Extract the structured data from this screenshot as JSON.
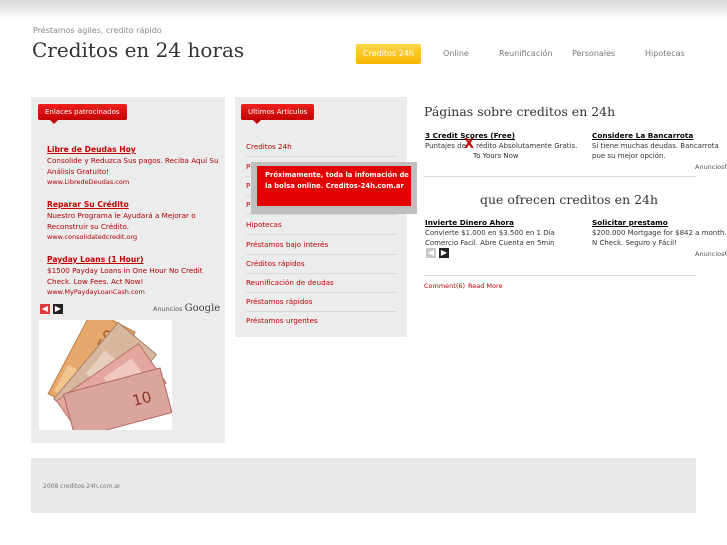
{
  "header": {
    "tagline": "Préstamos agiles, credito rápido",
    "site_title": "Creditos en 24 horas"
  },
  "nav": [
    {
      "label": "Creditos 24h",
      "active": true
    },
    {
      "label": "Online"
    },
    {
      "label": "Reunificación"
    },
    {
      "label": "Personales"
    },
    {
      "label": "Hipotecas"
    }
  ],
  "sidebar": {
    "title": "Enlaces patrocinados",
    "ads": [
      {
        "title": "Libre de Deudas Hoy",
        "desc": "Consolide y Reduzca Sus pagos. Reciba Aquí Su Análisis Gratuito!",
        "url": "www.LibredeDeudas.com"
      },
      {
        "title": "Reparar Su Crédito",
        "desc": "Nuestro Programa le Ayudará a Mejorar o Reconstruir su Crédito.",
        "url": "www.consolidatedcredit.org"
      },
      {
        "title": "Payday Loans (1 Hour)",
        "desc": "$1500 Payday Loans in One Hour No Credit Check. Low Fees. Act Now!",
        "url": "www.MyPaydayLoanCash.com"
      }
    ],
    "ads_by": "Anuncios",
    "ads_brand": "Google"
  },
  "articles": {
    "title": "Ultimos Articulos",
    "items": [
      "Creditos 24h",
      "P",
      "P",
      "P",
      "Hipotecas",
      "Préstamos bajo interés",
      "Créditos rápidos",
      "Reunificación de deudas",
      "Préstamos rápidos",
      "Préstamos urgentes"
    ]
  },
  "popup": {
    "text": "Próximamente, toda la infomación de la bolsa online. Creditos-24h.com.ar",
    "close": "X"
  },
  "main": {
    "section1_title": "Páginas sobre creditos en 24h",
    "section1_ads": [
      {
        "title": "3 Credit Scores (Free)",
        "desc_a": "Puntajes de",
        "desc_b": "rédito Absolutamente Gratis.",
        "desc_c": "To Yours Now"
      },
      {
        "title": "Considere La Bancarrota",
        "desc": "Si tiene muchas deudas. Bancarrota pue su mejor opción."
      }
    ],
    "section2_title": "que ofrecen creditos en 24h",
    "section2_ads": [
      {
        "title": "Invierte Dinero Ahora",
        "desc": "Convierte $1.000 en $3.500 en 1 Día Comercio Facil. Abre Cuenta en 5min"
      },
      {
        "title": "Solicitar prestamo",
        "desc": "$200.000 Mortgage for $842 a month. N Check. Seguro y Fácil!"
      }
    ],
    "ads_by": "Anuncios",
    "ads_brand": "G",
    "comments": "Comment(6)",
    "read_more": "Read More"
  },
  "footer": {
    "text": "2008 creditos-24h.com.ar"
  },
  "colors": {
    "accent_red": "#d40000",
    "nav_active": "#f6b500"
  }
}
